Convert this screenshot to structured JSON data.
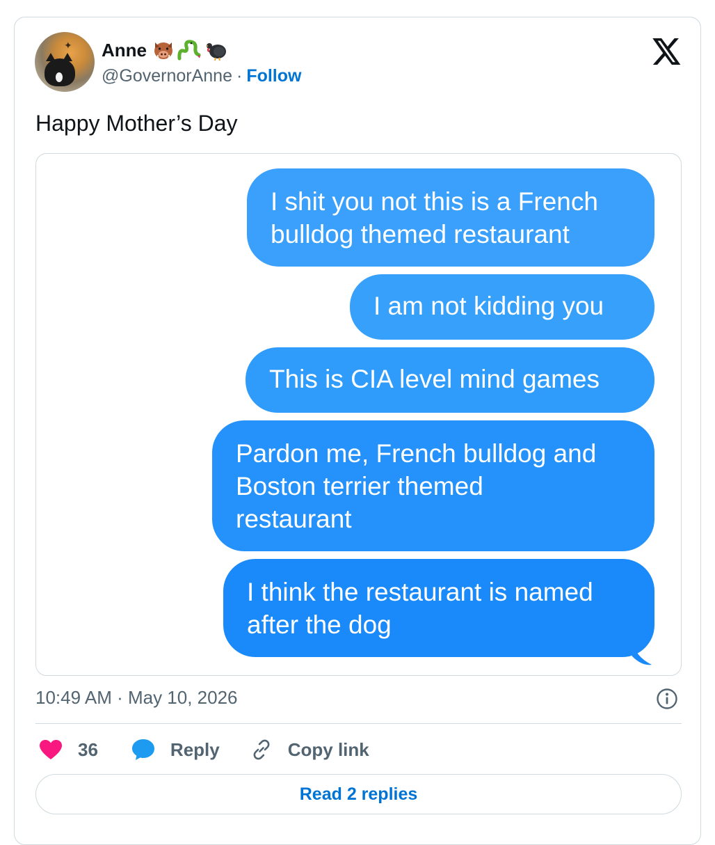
{
  "author": {
    "display_name": "Anne",
    "emojis": [
      "boar-emoji",
      "snake-emoji",
      "turkey-emoji"
    ],
    "handle": "@GovernorAnne",
    "separator": "·",
    "follow_label": "Follow"
  },
  "tweet": {
    "text": "Happy Mother’s Day",
    "timestamp": "10:49 AM · May 10, 2026"
  },
  "messages": [
    "I shit you not this is a French\nbulldog themed restaurant",
    "I am not kidding you",
    "This is CIA level mind games",
    "Pardon me, French bulldog and\nBoston terrier themed\nrestaurant",
    "I think the restaurant is named\nafter the dog"
  ],
  "actions": {
    "like_count": "36",
    "reply_label": "Reply",
    "copy_link_label": "Copy link"
  },
  "read_replies_label": "Read 2 replies",
  "colors": {
    "bubble_blue": "#1a8afa",
    "link_blue": "#0074d4",
    "like_pink": "#f91880",
    "reply_blue": "#1d9bf0"
  }
}
